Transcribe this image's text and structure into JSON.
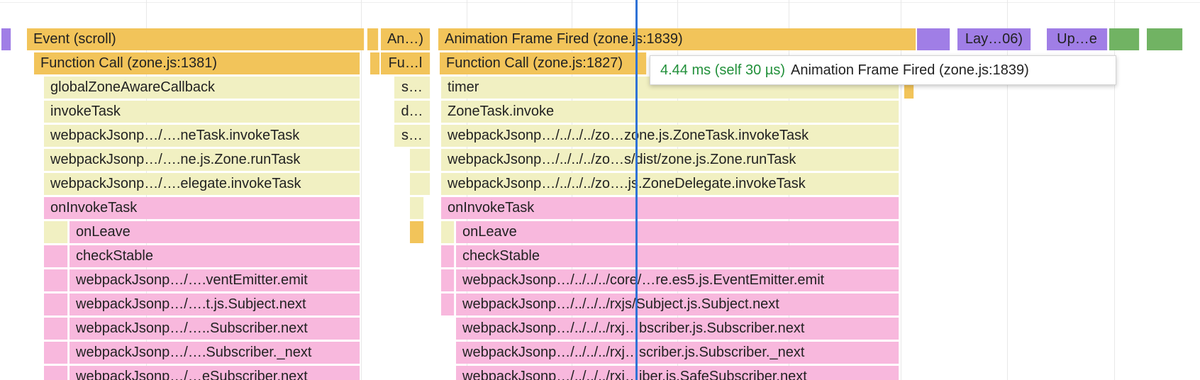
{
  "colors": {
    "event": "#f2c45a",
    "call": "#f2c45a",
    "js": "#f1f0c2",
    "zone": "#f8b8dd",
    "layout": "#a07ee6",
    "paint": "#71b363",
    "sliver": "#ead89a",
    "playhead": "#2f72d6",
    "tooltip_duration": "#21903a"
  },
  "tooltip": {
    "duration": "4.44 ms (self 30 µs)",
    "name": "Animation Frame Fired (zone.js:1839)"
  },
  "flame": [
    {
      "id": "pre-left-layout",
      "text": "",
      "kind": "layout"
    },
    {
      "id": "event-scroll",
      "text": "Event (scroll)",
      "kind": "event"
    },
    {
      "id": "sliver-a",
      "text": "",
      "kind": "event"
    },
    {
      "id": "animation-short",
      "text": "An…)",
      "kind": "event"
    },
    {
      "id": "animation-frame-fired",
      "text": "Animation Frame Fired (zone.js:1839)",
      "kind": "event"
    },
    {
      "id": "layout-gap",
      "text": "",
      "kind": "layout"
    },
    {
      "id": "layout-06",
      "text": "Lay…06)",
      "kind": "layout"
    },
    {
      "id": "update-e",
      "text": "Up…e",
      "kind": "layout"
    },
    {
      "id": "paint-a",
      "text": "",
      "kind": "paint"
    },
    {
      "id": "paint-b",
      "text": "",
      "kind": "paint"
    },
    {
      "id": "function-call-1381",
      "text": "Function Call (zone.js:1381)",
      "kind": "call"
    },
    {
      "id": "sliver-b",
      "text": "",
      "kind": "call"
    },
    {
      "id": "function-call-short",
      "text": "Fu…l",
      "kind": "call"
    },
    {
      "id": "function-call-1827",
      "text": "Function Call (zone.js:1827)",
      "kind": "call"
    },
    {
      "id": "global-zone-aware-callback",
      "text": "globalZoneAwareCallback",
      "kind": "js"
    },
    {
      "id": "short-s-1",
      "text": "s…",
      "kind": "js"
    },
    {
      "id": "timer",
      "text": "timer",
      "kind": "js"
    },
    {
      "id": "mini-call-1",
      "text": "",
      "kind": "call"
    },
    {
      "id": "invoke-task",
      "text": "invokeTask",
      "kind": "js"
    },
    {
      "id": "short-d",
      "text": "d…",
      "kind": "js"
    },
    {
      "id": "zone-task-invoke",
      "text": "ZoneTask.invoke",
      "kind": "js"
    },
    {
      "id": "left-zone-task-invoke-task",
      "text": "webpackJsonp…/….neTask.invokeTask",
      "kind": "js"
    },
    {
      "id": "short-s-2",
      "text": "s…",
      "kind": "js"
    },
    {
      "id": "right-zone-task-invoke-task",
      "text": "webpackJsonp…/../../../zo…zone.js.ZoneTask.invokeTask",
      "kind": "js"
    },
    {
      "id": "left-zone-run-task",
      "text": "webpackJsonp…/….ne.js.Zone.runTask",
      "kind": "js"
    },
    {
      "id": "mini-js-1",
      "text": "",
      "kind": "js"
    },
    {
      "id": "right-zone-run-task",
      "text": "webpackJsonp…/../../../zo…s/dist/zone.js.Zone.runTask",
      "kind": "js"
    },
    {
      "id": "left-delegate-invoke-task",
      "text": "webpackJsonp…/….elegate.invokeTask",
      "kind": "js"
    },
    {
      "id": "mini-js-2",
      "text": "",
      "kind": "js"
    },
    {
      "id": "right-delegate-invoke-task",
      "text": "webpackJsonp…/../../../zo….js.ZoneDelegate.invokeTask",
      "kind": "js"
    },
    {
      "id": "left-on-invoke-task",
      "text": "onInvokeTask",
      "kind": "zone"
    },
    {
      "id": "mini-js-3",
      "text": "",
      "kind": "js"
    },
    {
      "id": "right-on-invoke-task",
      "text": "onInvokeTask",
      "kind": "zone"
    },
    {
      "id": "left-gap-on-leave",
      "text": "",
      "kind": "js"
    },
    {
      "id": "left-on-leave",
      "text": "onLeave",
      "kind": "zone"
    },
    {
      "id": "mini-call-2",
      "text": "",
      "kind": "call"
    },
    {
      "id": "right-gap-on-leave",
      "text": "",
      "kind": "js"
    },
    {
      "id": "right-on-leave",
      "text": "onLeave",
      "kind": "zone"
    },
    {
      "id": "left-gap-check-stable",
      "text": "",
      "kind": "zone"
    },
    {
      "id": "left-check-stable",
      "text": "checkStable",
      "kind": "zone"
    },
    {
      "id": "right-gap-check-stable",
      "text": "",
      "kind": "zone"
    },
    {
      "id": "right-check-stable",
      "text": "checkStable",
      "kind": "zone"
    },
    {
      "id": "left-gap-emit",
      "text": "",
      "kind": "zone"
    },
    {
      "id": "left-event-emitter-emit",
      "text": "webpackJsonp…/….ventEmitter.emit",
      "kind": "zone"
    },
    {
      "id": "right-gap-emit",
      "text": "",
      "kind": "zone"
    },
    {
      "id": "right-event-emitter-emit",
      "text": "webpackJsonp…/../../../core/…re.es5.js.EventEmitter.emit",
      "kind": "zone"
    },
    {
      "id": "left-gap-subject",
      "text": "",
      "kind": "zone"
    },
    {
      "id": "left-subject-next",
      "text": "webpackJsonp…/….t.js.Subject.next",
      "kind": "zone"
    },
    {
      "id": "right-gap-subject",
      "text": "",
      "kind": "zone"
    },
    {
      "id": "right-subject-next",
      "text": "webpackJsonp…/../../../rxjs/Subject.js.Subject.next",
      "kind": "zone"
    },
    {
      "id": "left-gap-subscriber",
      "text": "",
      "kind": "zone"
    },
    {
      "id": "left-subscriber-next",
      "text": "webpackJsonp…/…..Subscriber.next",
      "kind": "zone"
    },
    {
      "id": "right-subscriber-next",
      "text": "webpackJsonp…/../../../rxj…bscriber.js.Subscriber.next",
      "kind": "zone"
    },
    {
      "id": "left-gap-subscriber-underscore",
      "text": "",
      "kind": "zone"
    },
    {
      "id": "left-subscriber-underscore-next",
      "text": "webpackJsonp…/….Subscriber._next",
      "kind": "zone"
    },
    {
      "id": "right-subscriber-underscore-next",
      "text": "webpackJsonp…/../../../rxj…scriber.js.Subscriber._next",
      "kind": "zone"
    },
    {
      "id": "left-gap-safe-subscriber",
      "text": "",
      "kind": "zone"
    },
    {
      "id": "left-safe-subscriber-next",
      "text": "webpackJsonp…/…eSubscriber.next",
      "kind": "zone"
    },
    {
      "id": "right-safe-subscriber-next",
      "text": "webpackJsonp…/../../../rxj…iber.js.SafeSubscriber.next",
      "kind": "zone"
    }
  ]
}
